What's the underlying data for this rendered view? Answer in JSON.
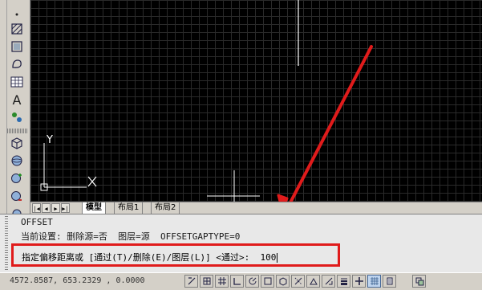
{
  "tabs": {
    "model": "模型",
    "layout1": "布局1",
    "layout2": "布局2"
  },
  "ucs": {
    "y": "Y",
    "x": "X"
  },
  "command_history": {
    "line1": "OFFSET",
    "line2": "当前设置: 删除源=否  图层=源  OFFSETGAPTYPE=0"
  },
  "command_prompt": {
    "text": "指定偏移距离或 [通过(T)/删除(E)/图层(L)] <通过>:  ",
    "value": "100"
  },
  "status": {
    "coordinates": "4572.8587, 653.2329 , 0.0000"
  },
  "colors": {
    "highlight_box": "#e01b1b",
    "arrow": "#e01b1b",
    "canvas_bg": "#000000"
  }
}
